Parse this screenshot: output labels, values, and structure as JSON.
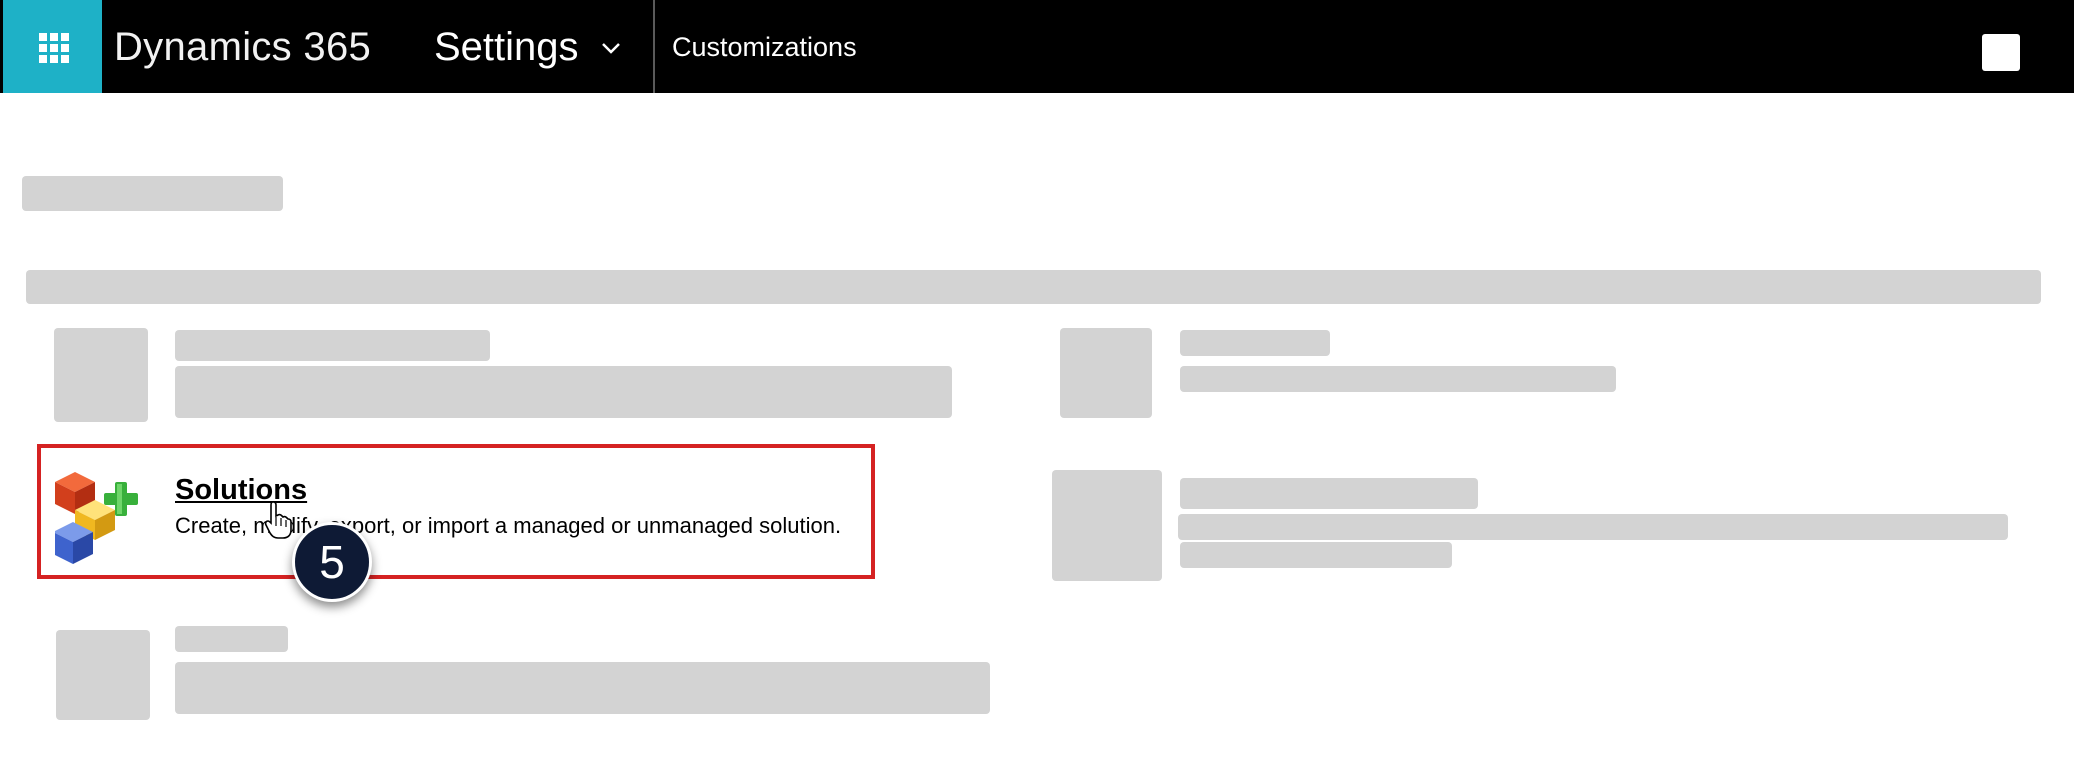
{
  "header": {
    "app_name": "Dynamics 365",
    "area_label": "Settings",
    "breadcrumb": "Customizations"
  },
  "solutions": {
    "title": "Solutions",
    "description": "Create, modify, export, or import a managed or unmanaged solution."
  },
  "step_badge": "5",
  "colors": {
    "topbar": "#000000",
    "waffle": "#1eb1c7",
    "highlight": "#d52222",
    "placeholder": "#d3d3d3",
    "badge": "#0e1a35"
  },
  "icons": [
    "app-launcher-icon",
    "chevron-down-icon",
    "solutions-icon",
    "hand-cursor-icon"
  ]
}
